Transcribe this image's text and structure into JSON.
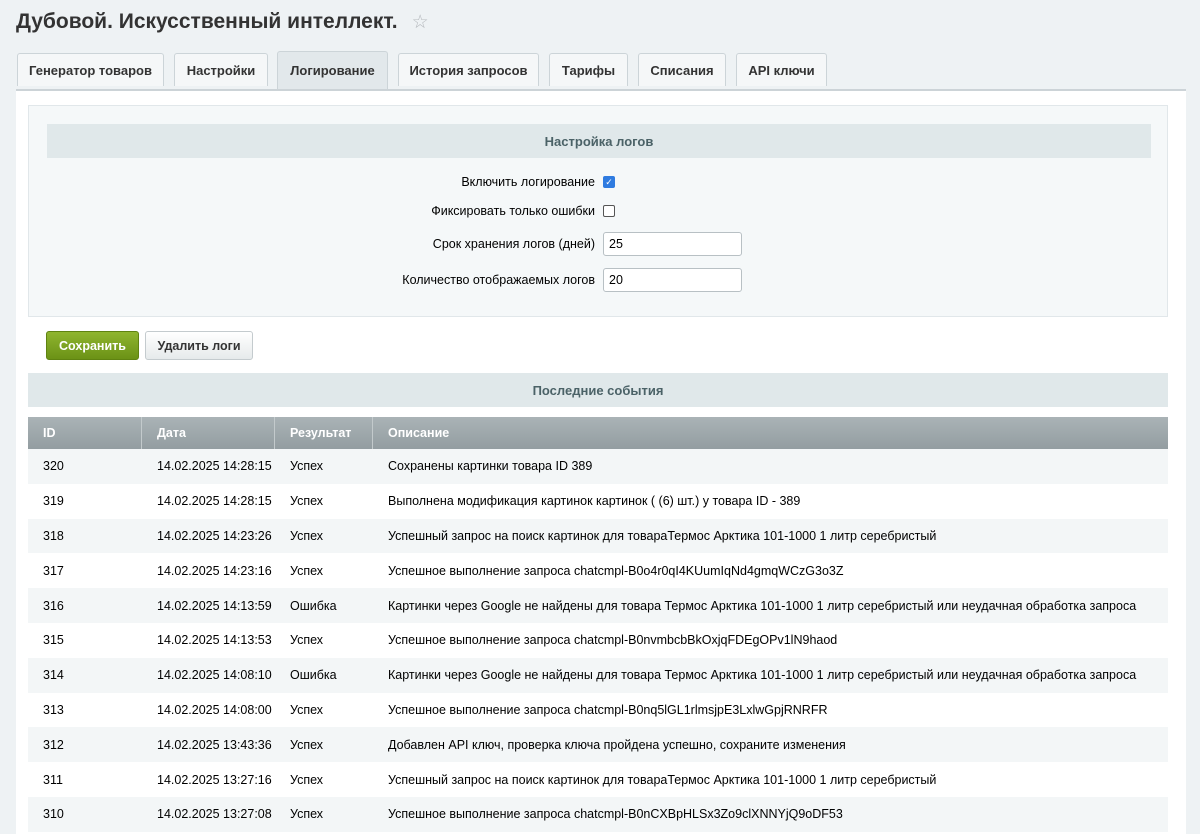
{
  "page": {
    "title": "Дубовой. Искусственный интеллект.",
    "favorite_icon": "star-outline"
  },
  "tabs": [
    {
      "label": "Генератор товаров"
    },
    {
      "label": "Настройки"
    },
    {
      "label": "Логирование",
      "active": true
    },
    {
      "label": "История запросов"
    },
    {
      "label": "Тарифы"
    },
    {
      "label": "Списания"
    },
    {
      "label": "API ключи"
    }
  ],
  "settings": {
    "header": "Настройка логов",
    "enable_logging_label": "Включить логирование",
    "enable_logging_checked": true,
    "errors_only_label": "Фиксировать только ошибки",
    "errors_only_checked": false,
    "retention_label": "Срок хранения логов (дней)",
    "retention_value": "25",
    "count_label": "Количество отображаемых логов",
    "count_value": "20"
  },
  "buttons": {
    "save": "Сохранить",
    "delete_logs": "Удалить логи"
  },
  "events": {
    "header": "Последние события",
    "columns": [
      "ID",
      "Дата",
      "Результат",
      "Описание"
    ],
    "rows": [
      {
        "id": "320",
        "date": "14.02.2025 14:28:15",
        "result": "Успех",
        "description": "Сохранены картинки товара ID 389"
      },
      {
        "id": "319",
        "date": "14.02.2025 14:28:15",
        "result": "Успех",
        "description": "Выполнена модификация картинок картинок ( (6) шт.) у товара ID - 389"
      },
      {
        "id": "318",
        "date": "14.02.2025 14:23:26",
        "result": "Успех",
        "description": "Успешный запрос на поиск картинок для товараТермос Арктика 101-1000 1 литр серебристый"
      },
      {
        "id": "317",
        "date": "14.02.2025 14:23:16",
        "result": "Успех",
        "description": "Успешное выполнение запроса chatcmpl-B0o4r0qI4KUumIqNd4gmqWCzG3o3Z"
      },
      {
        "id": "316",
        "date": "14.02.2025 14:13:59",
        "result": "Ошибка",
        "description": "Картинки через Google не найдены для товара Термос Арктика 101-1000 1 литр серебристый или неудачная обработка запроса"
      },
      {
        "id": "315",
        "date": "14.02.2025 14:13:53",
        "result": "Успех",
        "description": "Успешное выполнение запроса chatcmpl-B0nvmbcbBkOxjqFDEgOPv1lN9haod"
      },
      {
        "id": "314",
        "date": "14.02.2025 14:08:10",
        "result": "Ошибка",
        "description": "Картинки через Google не найдены для товара Термос Арктика 101-1000 1 литр серебристый или неудачная обработка запроса"
      },
      {
        "id": "313",
        "date": "14.02.2025 14:08:00",
        "result": "Успех",
        "description": "Успешное выполнение запроса chatcmpl-B0nq5lGL1rlmsjpE3LxlwGpjRNRFR"
      },
      {
        "id": "312",
        "date": "14.02.2025 13:43:36",
        "result": "Успех",
        "description": "Добавлен API ключ, проверка ключа пройдена успешно, сохраните изменения"
      },
      {
        "id": "311",
        "date": "14.02.2025 13:27:16",
        "result": "Успех",
        "description": "Успешный запрос на поиск картинок для товараТермос Арктика 101-1000 1 литр серебристый"
      },
      {
        "id": "310",
        "date": "14.02.2025 13:27:08",
        "result": "Успех",
        "description": "Успешное выполнение запроса chatcmpl-B0nCXBpHLSx3Zo9clXNNYjQ9oDF53"
      }
    ]
  },
  "colors": {
    "save_button": "#7aa321",
    "section_header_bg": "#e0e8ea",
    "table_header_bg": "#9aa4a8",
    "checkbox_checked": "#2f7be0"
  }
}
